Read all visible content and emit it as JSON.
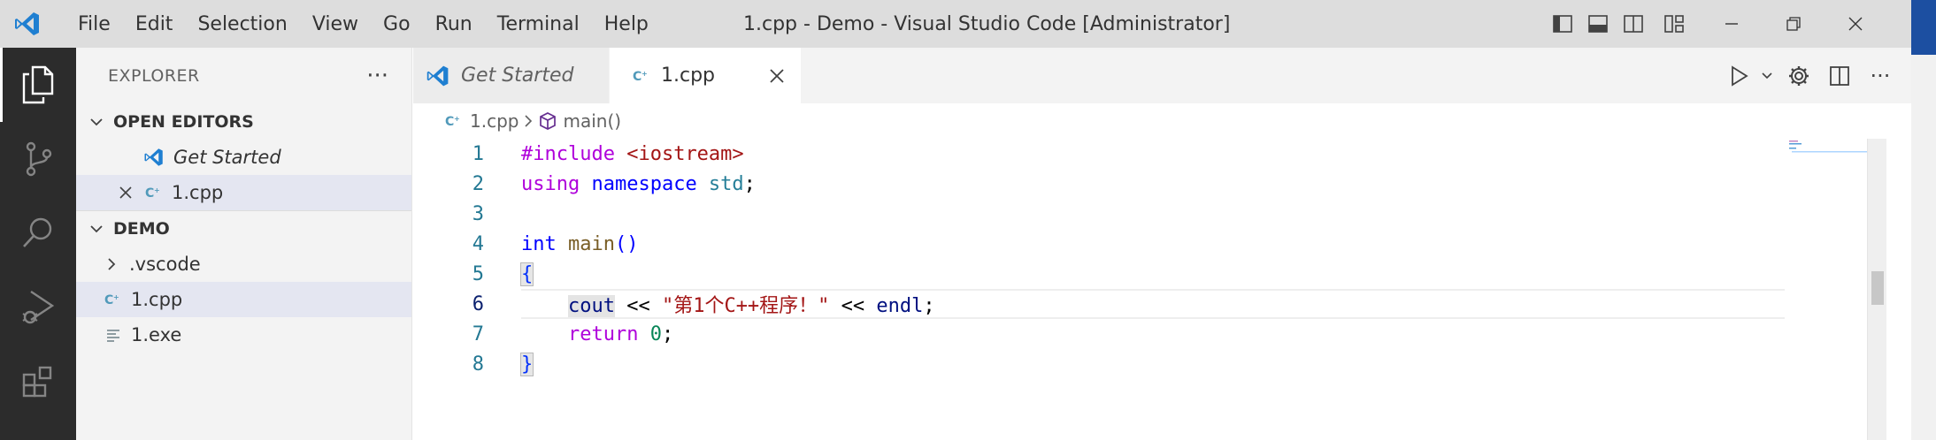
{
  "titlebar": {
    "menu": [
      "File",
      "Edit",
      "Selection",
      "View",
      "Go",
      "Run",
      "Terminal",
      "Help"
    ],
    "window_title": "1.cpp - Demo - Visual Studio Code [Administrator]"
  },
  "activity_bar": {
    "items": [
      "explorer-icon",
      "source-control-icon",
      "search-icon",
      "run-debug-icon",
      "extensions-icon"
    ]
  },
  "sidebar": {
    "title": "EXPLORER",
    "open_editors": {
      "label": "OPEN EDITORS",
      "items": [
        "Get Started",
        "1.cpp"
      ]
    },
    "demo": {
      "label": "DEMO",
      "items": [
        ".vscode",
        "1.cpp",
        "1.exe"
      ]
    }
  },
  "tabs": [
    {
      "label": "Get Started",
      "active": false
    },
    {
      "label": "1.cpp",
      "active": true
    }
  ],
  "breadcrumb": {
    "file": "1.cpp",
    "symbol": "main()"
  },
  "code": {
    "line_numbers": [
      "1",
      "2",
      "3",
      "4",
      "5",
      "6",
      "7",
      "8"
    ],
    "current_line": 6,
    "lines": {
      "l1a": "#include",
      "l1b": " <iostream>",
      "l2a": "using",
      "l2b": " namespace",
      "l2c": " std",
      "l2d": ";",
      "l4a": "int",
      "l4b": " main",
      "l4c": "()",
      "l5a": "{",
      "l6a": "cout",
      "l6b": " << ",
      "l6c": "\"第1个C++程序！\"",
      "l6d": " << ",
      "l6e": "endl",
      "l6f": ";",
      "l7a": "return",
      "l7b": " 0",
      "l7c": ";",
      "l8a": "}"
    }
  },
  "colors": {
    "accent": "#007acc",
    "titlebar_bg": "#dddddd",
    "activitybar_bg": "#2c2c2c",
    "sidebar_bg": "#f3f3f3",
    "selection_bg": "#e4e6f1"
  }
}
